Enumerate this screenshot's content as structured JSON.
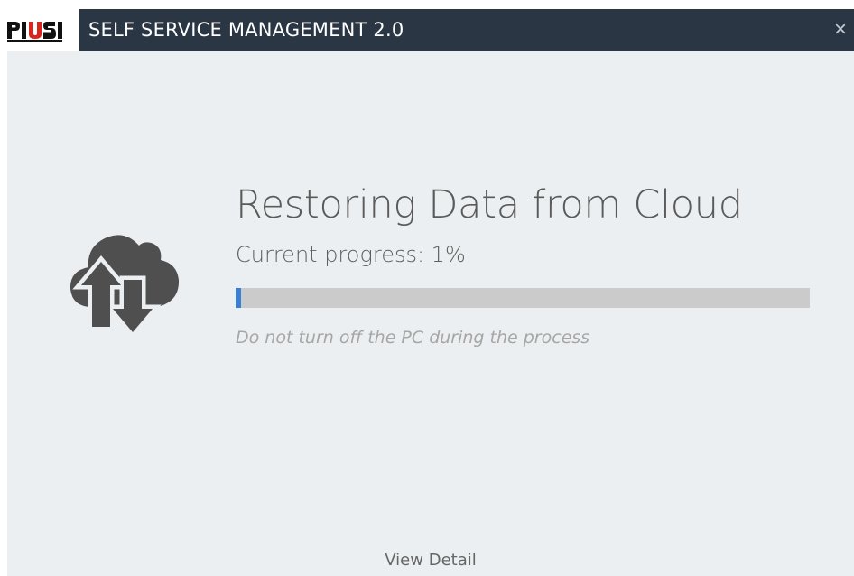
{
  "app": {
    "logo_text": "PIUSI",
    "title": "SELF SERVICE MANAGEMENT 2.0",
    "close_glyph": "×",
    "colors": {
      "titlebar": "#2b3645",
      "background": "#eceff1",
      "progress_fill": "#3a7fd5",
      "progress_track": "#cbcbcb",
      "logo_red": "#d7261e"
    }
  },
  "main": {
    "icon": "cloud-upload-download-icon",
    "heading": "Restoring Data from Cloud",
    "progress_text": "Current progress: 1%",
    "progress_fraction": 0.01,
    "warning": "Do not turn off the PC during the process",
    "view_detail": "View Detail"
  }
}
